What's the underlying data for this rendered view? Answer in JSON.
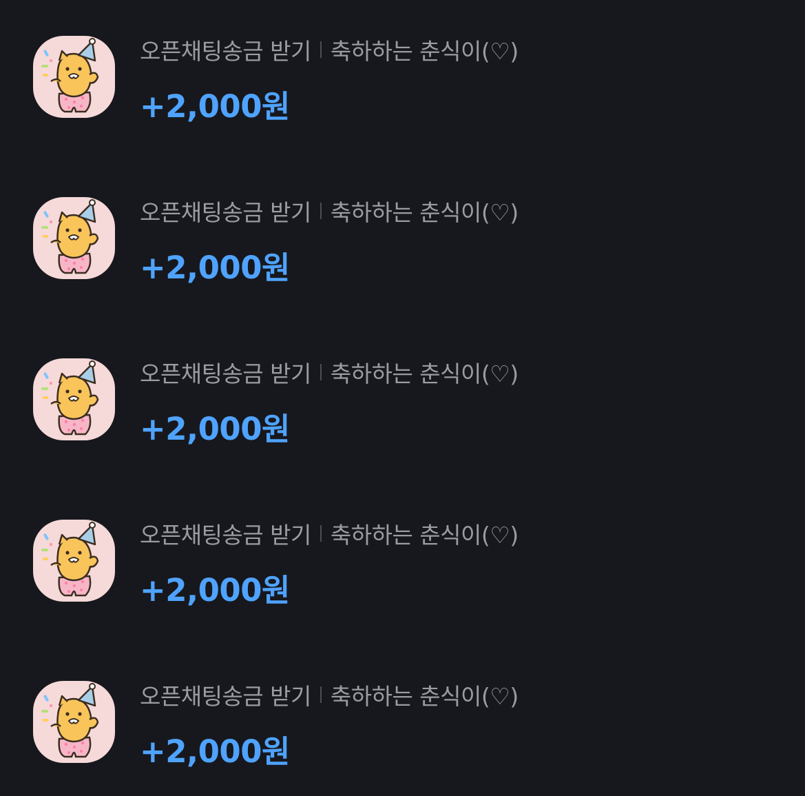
{
  "colors": {
    "background": "#17181d",
    "title": "#9b9ca3",
    "amount": "#4fa3ff",
    "avatar_bg": "#f6d9d9"
  },
  "transactions": [
    {
      "category": "오픈채팅송금 받기",
      "memo": "축하하는 춘식이(♡)",
      "amount": "+2,000원",
      "icon": "choonsik-party-hat-icon"
    },
    {
      "category": "오픈채팅송금 받기",
      "memo": "축하하는 춘식이(♡)",
      "amount": "+2,000원",
      "icon": "choonsik-party-hat-icon"
    },
    {
      "category": "오픈채팅송금 받기",
      "memo": "축하하는 춘식이(♡)",
      "amount": "+2,000원",
      "icon": "choonsik-party-hat-icon"
    },
    {
      "category": "오픈채팅송금 받기",
      "memo": "축하하는 춘식이(♡)",
      "amount": "+2,000원",
      "icon": "choonsik-party-hat-icon"
    },
    {
      "category": "오픈채팅송금 받기",
      "memo": "축하하는 춘식이(♡)",
      "amount": "+2,000원",
      "icon": "choonsik-party-hat-icon"
    }
  ]
}
